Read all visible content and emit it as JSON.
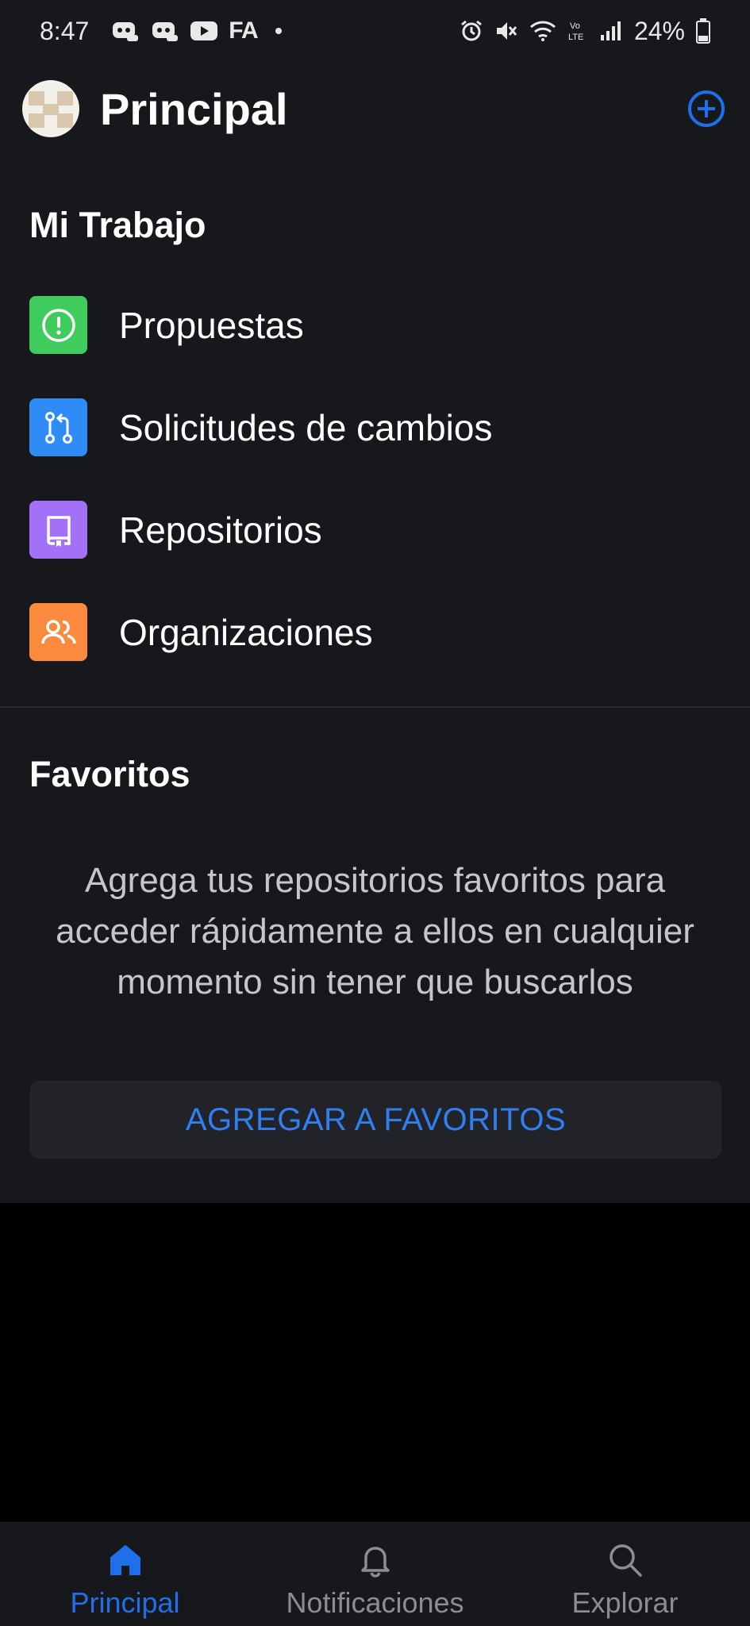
{
  "status_bar": {
    "time": "8:47",
    "fa_label": "FA",
    "battery_percent": "24%",
    "icons": [
      "discord-icon",
      "discord-icon",
      "youtube-icon",
      "alarm-icon",
      "mute-icon",
      "wifi-icon",
      "volte-icon",
      "signal-icon",
      "battery-icon"
    ]
  },
  "header": {
    "title": "Principal"
  },
  "my_work": {
    "title": "Mi Trabajo",
    "items": [
      {
        "label": "Propuestas",
        "icon": "issue-icon",
        "color": "#3fcc5c"
      },
      {
        "label": "Solicitudes de cambios",
        "icon": "pull-request-icon",
        "color": "#2f8cf6"
      },
      {
        "label": "Repositorios",
        "icon": "repo-icon",
        "color": "#a371f7"
      },
      {
        "label": "Organizaciones",
        "icon": "people-icon",
        "color": "#fb8a3e"
      }
    ]
  },
  "favorites": {
    "title": "Favoritos",
    "message": "Agrega tus repositorios favoritos para acceder rápidamente a ellos en cualquier momento sin tener que buscarlos",
    "button_label": "AGREGAR A FAVORITOS"
  },
  "bottom_nav": {
    "items": [
      {
        "label": "Principal",
        "icon": "home-icon",
        "active": true
      },
      {
        "label": "Notificaciones",
        "icon": "bell-icon",
        "active": false
      },
      {
        "label": "Explorar",
        "icon": "search-icon",
        "active": false
      }
    ]
  },
  "colors": {
    "accent": "#1f6feb",
    "background": "#17181c",
    "inactive_nav": "#8b8d93"
  }
}
